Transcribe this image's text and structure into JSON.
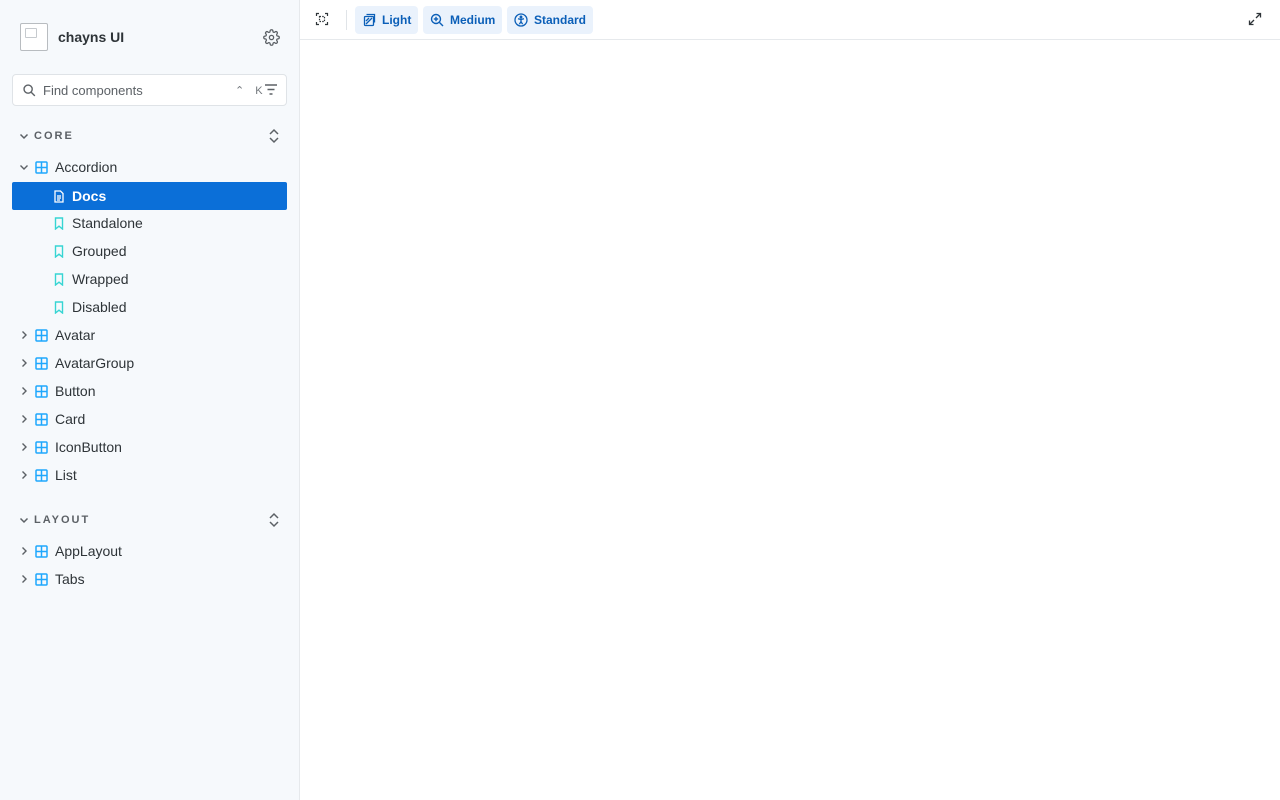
{
  "app": {
    "title": "chayns UI"
  },
  "search": {
    "placeholder": "Find components",
    "shortcut": "⌃ K"
  },
  "sections": [
    {
      "label": "CORE",
      "items": [
        {
          "label": "Accordion",
          "expanded": true,
          "children": [
            {
              "label": "Docs",
              "type": "docs",
              "selected": true
            },
            {
              "label": "Standalone",
              "type": "story"
            },
            {
              "label": "Grouped",
              "type": "story"
            },
            {
              "label": "Wrapped",
              "type": "story"
            },
            {
              "label": "Disabled",
              "type": "story"
            }
          ]
        },
        {
          "label": "Avatar"
        },
        {
          "label": "AvatarGroup"
        },
        {
          "label": "Button"
        },
        {
          "label": "Card"
        },
        {
          "label": "IconButton"
        },
        {
          "label": "List"
        }
      ]
    },
    {
      "label": "LAYOUT",
      "items": [
        {
          "label": "AppLayout"
        },
        {
          "label": "Tabs"
        }
      ]
    }
  ],
  "toolbar": {
    "theme_label": "Light",
    "size_label": "Medium",
    "accessibility_label": "Standard"
  },
  "colors": {
    "accent": "#0b6fd8",
    "component_icon": "#1ea7fd",
    "story_icon": "#37d5d3",
    "sidebar_bg": "#f6f9fc"
  }
}
